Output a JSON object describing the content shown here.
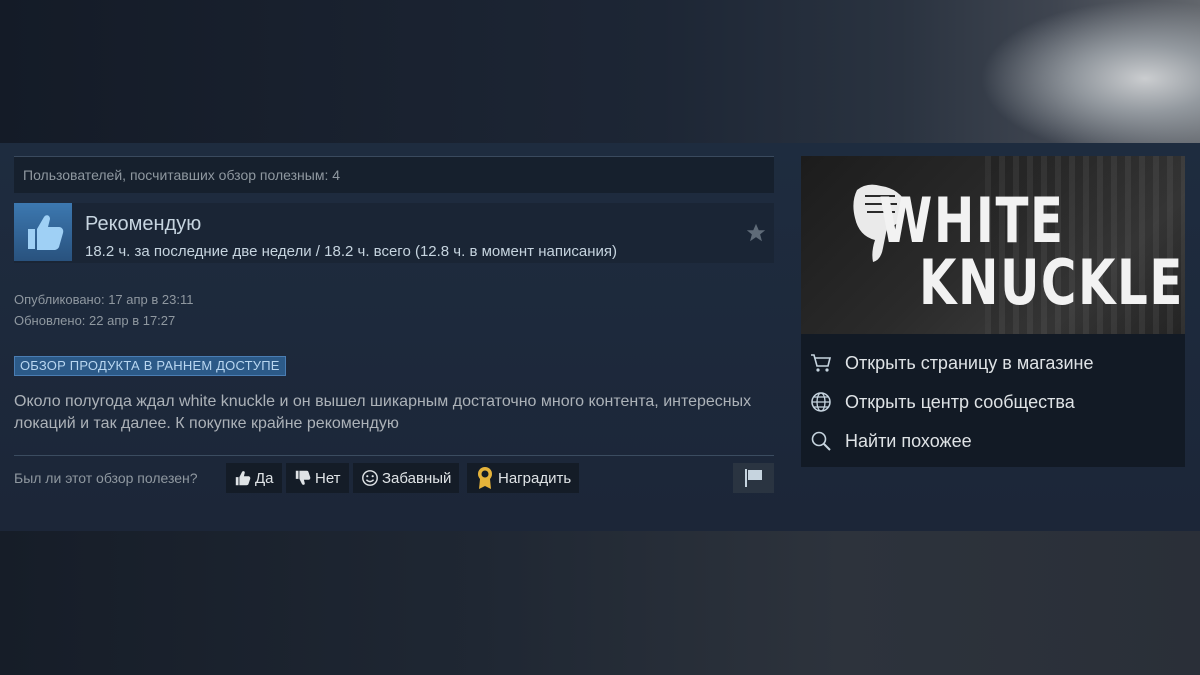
{
  "helpful_count_text": "Пользователей, посчитавших обзор полезным: 4",
  "recommendation": {
    "title": "Рекомендую",
    "hours": "18.2 ч. за последние две недели / 18.2 ч. всего (12.8 ч. в момент написания)"
  },
  "dates": {
    "published": "Опубликовано: 17 апр в 23:11",
    "updated": "Обновлено: 22 апр в 17:27"
  },
  "early_access_badge": "ОБЗОР ПРОДУКТА В РАННЕМ ДОСТУПЕ",
  "review_text": "Около полугода ждал white knuckle и он вышел шикарным достаточно много контента, интересных локаций и так далее. К покупке крайне рекомендую",
  "voting": {
    "question": "Был ли этот обзор полезен?",
    "yes_label": "Да",
    "no_label": "Нет",
    "funny_label": "Забавный",
    "award_label": "Наградить"
  },
  "game": {
    "logo_line1": "WHITE",
    "logo_line2": "KNUCKLE"
  },
  "side_links": {
    "store": "Открыть страницу в магазине",
    "community": "Открыть центр сообщества",
    "similar": "Найти похожее"
  },
  "icons": [
    "thumbs-up-icon",
    "star-icon",
    "thumbs-down-icon",
    "smile-icon",
    "award-icon",
    "flag-icon",
    "cart-icon",
    "globe-icon",
    "search-icon"
  ],
  "colors": {
    "accent": "#2c5a88",
    "background": "#1b2433",
    "award": "#e5b33a"
  }
}
